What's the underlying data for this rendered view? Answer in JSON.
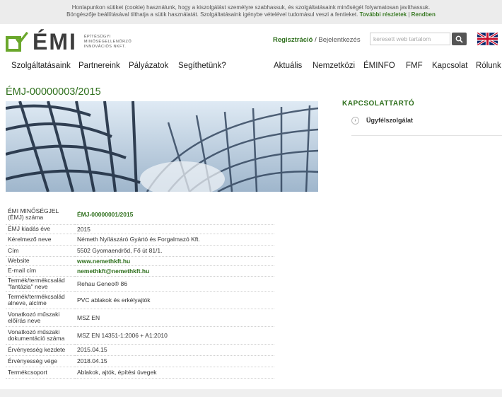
{
  "cookie": {
    "line1": "Honlapunkon sütiket (cookie) használunk, hogy a kiszolgálást személyre szabhassuk, és szolgáltatásaink minőségét folyamatosan javíthassuk.",
    "line2": "Böngészője beállításával tilthatja a sütik használatát. Szolgáltatásaink igénybe vételével tudomásul veszi a fentieket.",
    "more": "További részletek",
    "sep": " | ",
    "ok": "Rendben"
  },
  "logo": {
    "word": "ÉMI",
    "sub1": "ÉPÍTÉSÜGYI",
    "sub2": "MINŐSÉGELLENŐRZŐ",
    "sub3": "INNOVÁCIÓS NKFT."
  },
  "header": {
    "register": "Regisztráció",
    "slash": " / ",
    "login": "Bejelentkezés",
    "search_placeholder": "keresett web tartalom",
    "search_icon": "magnifier-icon",
    "flag_icon": "uk-flag-icon"
  },
  "nav": {
    "left": [
      "Szolgáltatásaink",
      "Partnereink",
      "Pályázatok",
      "Segíthetünk?"
    ],
    "right": [
      "Aktuális",
      "Nemzetközi",
      "ÉMINFO",
      "FMF",
      "Kapcsolat",
      "Rólunk"
    ]
  },
  "page": {
    "title": "ÉMJ-00000003/2015"
  },
  "sidebar": {
    "title": "KAPCSOLATTARTÓ",
    "item": "Ügyfélszolgálat"
  },
  "table": [
    {
      "k": "ÉMI MINŐSÉGJEL (ÉMJ) száma",
      "v": "ÉMJ-00000001/2015",
      "green": true
    },
    {
      "k": "ÉMJ kiadás éve",
      "v": "2015",
      "green": false
    },
    {
      "k": "Kérelmező neve",
      "v": "Németh Nyílászáró Gyártó és Forgalmazó Kft.",
      "green": false
    },
    {
      "k": "Cím",
      "v": "5502 Gyomaendrőd, Fő út 81/1.",
      "green": false
    },
    {
      "k": "Website",
      "v": "www.nemethkft.hu",
      "green": true
    },
    {
      "k": "E-mail cím",
      "v": "nemethkft@nemethkft.hu",
      "green": true
    },
    {
      "k": "Termék/termékcsalád \"fantázia\" neve",
      "v": "Rehau Geneo® 86",
      "green": false
    },
    {
      "k": "Termék/termékcsalád alneve, alcíme",
      "v": "PVC ablakok és erkélyajtók",
      "green": false
    },
    {
      "k": "Vonatkozó műszaki előírás neve",
      "v": "MSZ EN",
      "green": false
    },
    {
      "k": "Vonatkozó műszaki dokumentáció száma",
      "v": "MSZ EN 14351-1:2006 + A1:2010",
      "green": false
    },
    {
      "k": "Érvényesség kezdete",
      "v": "2015.04.15",
      "green": false
    },
    {
      "k": "Érvényesség vége",
      "v": "2018.04.15",
      "green": false
    },
    {
      "k": "Termékcsoport",
      "v": "Ablakok, ajtók, építési üvegek",
      "green": false
    }
  ]
}
